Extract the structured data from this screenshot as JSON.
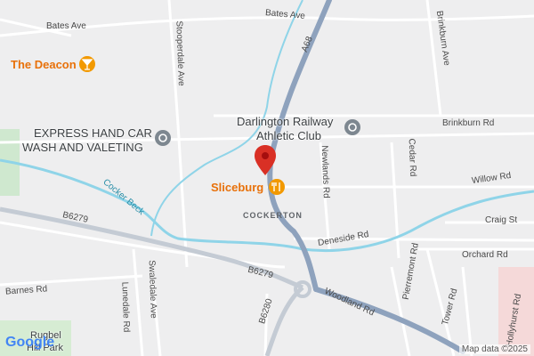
{
  "map": {
    "streets": {
      "bates_ave_top": "Bates Ave",
      "bates_ave_left": "Bates Ave",
      "a68": "A68",
      "stooperdale_ave": "Stooperdale Ave",
      "brinkburn_ave": "Brinkburn Ave",
      "brinkburn_rd": "Brinkburn Rd",
      "cedar_rd": "Cedar Rd",
      "newlands_rd": "Newlands Rd",
      "willow_rd": "Willow Rd",
      "craig_st": "Craig St",
      "orchard_rd": "Orchard Rd",
      "deneside_rd": "Deneside Rd",
      "b6279_left": "B6279",
      "b6279_center": "B6279",
      "b6280": "B6280",
      "woodland_rd": "Woodland Rd",
      "pierremont_rd": "Pierremont Rd",
      "tower_rd": "Tower Rd",
      "hollyhurst_rd": "Hollyhurst Rd",
      "lunedale_rd": "Lunedale Rd",
      "swaledale_ave": "Swaledale Ave",
      "barnes_rd": "Barnes Rd"
    },
    "places": {
      "the_deacon": "The Deacon",
      "express_line1": "EXPRESS HAND CAR",
      "express_line2": "WASH AND VALETING",
      "railway_line1": "Darlington Railway",
      "railway_line2": "Athletic Club",
      "sliceburg": "Sliceburg",
      "cockerton": "COCKERTON",
      "cocker_beck": "Cocker Beck",
      "park_line1": "Rugbel",
      "park_line2": "Hill Park"
    },
    "logo": "Google",
    "attribution": "Map data ©2025",
    "colors": {
      "river": "#8fd4e8",
      "major_road": "#8ea2bd",
      "minor_road": "#ffffff",
      "pin": "#d93025",
      "food": "#f29900"
    }
  }
}
